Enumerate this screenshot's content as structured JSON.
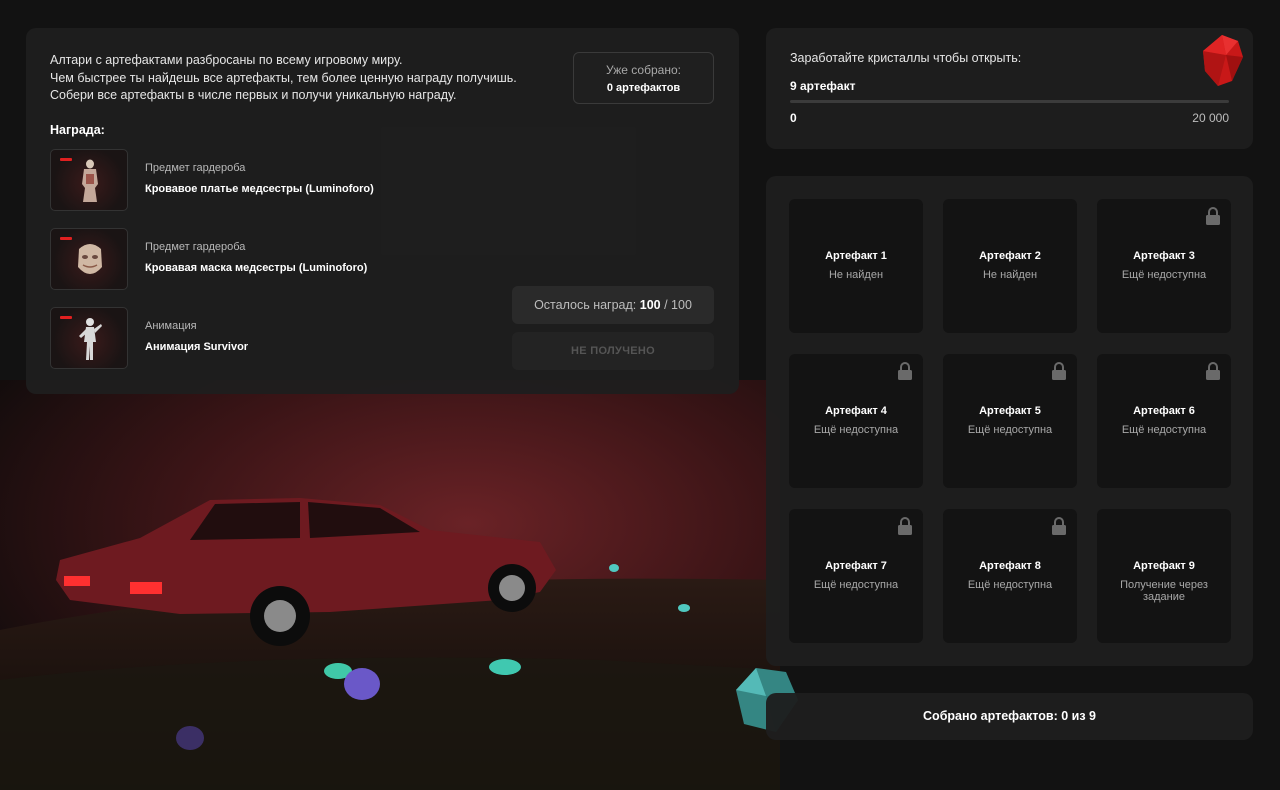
{
  "info": {
    "lines": [
      "Алтари с артефактами разбросаны по всему игровому миру.",
      "Чем быстрее ты найдешь все артефакты, тем более ценную награду получишь.",
      "Собери все артефакты в числе первых и получи уникальную награду."
    ],
    "collected_label": "Уже собрано:",
    "collected_value": "0 артефактов",
    "reward_title": "Награда:",
    "rewards": [
      {
        "type": "Предмет гардероба",
        "name": "Кровавое платье медсестры (Luminoforo)",
        "icon": "dress-icon"
      },
      {
        "type": "Предмет гардероба",
        "name": "Кровавая маска медсестры (Luminoforo)",
        "icon": "mask-icon"
      },
      {
        "type": "Анимация",
        "name": "Анимация Survivor",
        "icon": "figure-icon"
      }
    ],
    "remaining_label": "Осталось наград:",
    "remaining_count": "100",
    "remaining_total": "/ 100",
    "not_received_label": "НЕ ПОЛУЧЕНО"
  },
  "crystals": {
    "title": "Заработайте кристаллы чтобы открыть:",
    "goal": "9 артефакт",
    "min": "0",
    "max": "20 000",
    "progress_fraction": 0,
    "accent_color": "#d02020",
    "icon": "red-crystal-icon"
  },
  "artifacts": [
    {
      "name": "Артефакт 1",
      "status": "Не найден",
      "locked": false
    },
    {
      "name": "Артефакт 2",
      "status": "Не найден",
      "locked": false
    },
    {
      "name": "Артефакт 3",
      "status": "Ещё недоступна",
      "locked": true
    },
    {
      "name": "Артефакт 4",
      "status": "Ещё недоступна",
      "locked": true
    },
    {
      "name": "Артефакт 5",
      "status": "Ещё недоступна",
      "locked": true
    },
    {
      "name": "Артефакт 6",
      "status": "Ещё недоступна",
      "locked": true
    },
    {
      "name": "Артефакт 7",
      "status": "Ещё недоступна",
      "locked": true
    },
    {
      "name": "Артефакт 8",
      "status": "Ещё недоступна",
      "locked": true
    },
    {
      "name": "Артефакт 9",
      "status": "Получение через задание",
      "locked": false
    }
  ],
  "counter": {
    "label": "Собрано артефактов: 0 из 9"
  }
}
